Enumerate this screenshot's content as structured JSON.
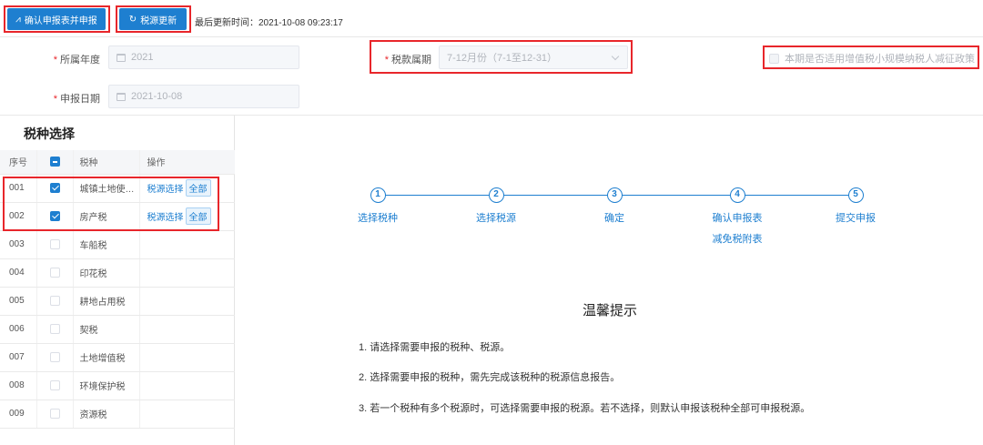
{
  "toolbar": {
    "confirm_label": "确认申报表并申报",
    "refresh_label": "税源更新",
    "update_time": "最后更新时间：2021-10-08 09:23:17"
  },
  "form": {
    "year_label": "所属年度",
    "year_value": "2021",
    "period_label": "税款属期",
    "period_value": "7-12月份（7-1至12-31）",
    "date_label": "申报日期",
    "date_value": "2021-10-08",
    "policy_label": "本期是否适用增值税小规模纳税人减征政策"
  },
  "tax_panel": {
    "title": "税种选择",
    "columns": [
      "序号",
      "",
      "税种",
      "操作"
    ],
    "op_select": "税源选择",
    "op_all": "全部",
    "rows": [
      {
        "no": "001",
        "name": "城镇土地使用税",
        "checked": true,
        "has_ops": true
      },
      {
        "no": "002",
        "name": "房产税",
        "checked": true,
        "has_ops": true
      },
      {
        "no": "003",
        "name": "车船税",
        "checked": false,
        "has_ops": false
      },
      {
        "no": "004",
        "name": "印花税",
        "checked": false,
        "has_ops": false
      },
      {
        "no": "005",
        "name": "耕地占用税",
        "checked": false,
        "has_ops": false
      },
      {
        "no": "006",
        "name": "契税",
        "checked": false,
        "has_ops": false
      },
      {
        "no": "007",
        "name": "土地增值税",
        "checked": false,
        "has_ops": false
      },
      {
        "no": "008",
        "name": "环境保护税",
        "checked": false,
        "has_ops": false
      },
      {
        "no": "009",
        "name": "资源税",
        "checked": false,
        "has_ops": false
      }
    ]
  },
  "steps": [
    {
      "num": "1",
      "label": "选择税种"
    },
    {
      "num": "2",
      "label": "选择税源"
    },
    {
      "num": "3",
      "label": "确定"
    },
    {
      "num": "4",
      "label": "确认申报表",
      "label2": "减免税附表"
    },
    {
      "num": "5",
      "label": "提交申报"
    }
  ],
  "tips": {
    "title": "温馨提示",
    "items": [
      "1. 请选择需要申报的税种、税源。",
      "2. 选择需要申报的税种，需先完成该税种的税源信息报告。",
      "3. 若一个税种有多个税源时，可选择需要申报的税源。若不选择，则默认申报该税种全部可申报税源。"
    ]
  },
  "colors": {
    "accent": "#1e7fd0",
    "highlight": "#e8262b"
  }
}
